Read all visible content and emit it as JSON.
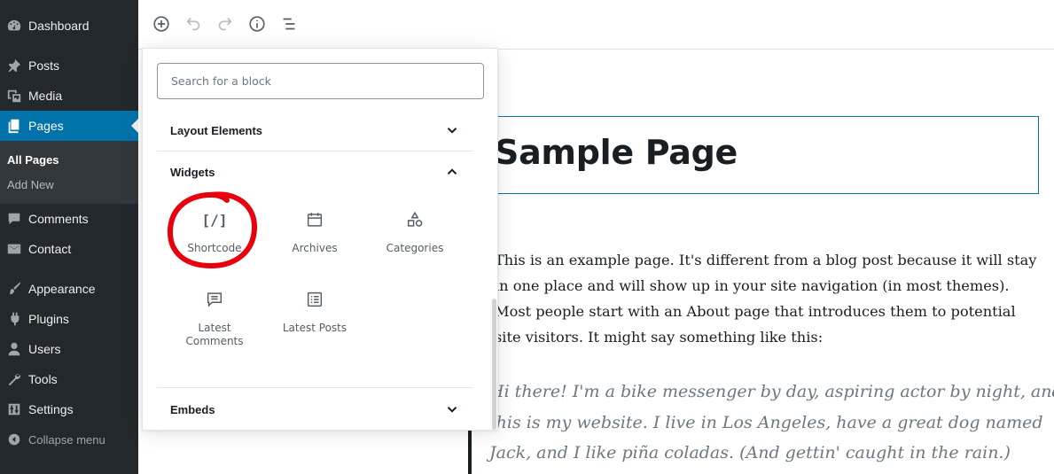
{
  "sidebar": {
    "items": [
      {
        "key": "dashboard",
        "label": "Dashboard",
        "icon": "dashboard-icon"
      },
      {
        "key": "posts",
        "label": "Posts",
        "icon": "pin-icon"
      },
      {
        "key": "media",
        "label": "Media",
        "icon": "media-icon"
      },
      {
        "key": "pages",
        "label": "Pages",
        "icon": "pages-icon",
        "active": true
      },
      {
        "key": "comments",
        "label": "Comments",
        "icon": "comment-icon"
      },
      {
        "key": "contact",
        "label": "Contact",
        "icon": "envelope-icon"
      },
      {
        "key": "appearance",
        "label": "Appearance",
        "icon": "paintbrush-icon"
      },
      {
        "key": "plugins",
        "label": "Plugins",
        "icon": "plug-icon"
      },
      {
        "key": "users",
        "label": "Users",
        "icon": "user-icon"
      },
      {
        "key": "tools",
        "label": "Tools",
        "icon": "wrench-icon"
      },
      {
        "key": "settings",
        "label": "Settings",
        "icon": "sliders-icon"
      }
    ],
    "submenu": [
      {
        "label": "All Pages",
        "current": true
      },
      {
        "label": "Add New"
      }
    ],
    "collapse_label": "Collapse menu",
    "accent_color": "#0073aa"
  },
  "toolbar": {
    "buttons": [
      "add-block-icon",
      "undo-icon",
      "redo-icon",
      "info-icon",
      "outline-icon"
    ]
  },
  "inserter": {
    "search_placeholder": "Search for a block",
    "sections": {
      "layout": {
        "label": "Layout Elements",
        "expanded": false
      },
      "widgets": {
        "label": "Widgets",
        "expanded": true,
        "blocks": [
          {
            "label": "Shortcode",
            "glyph": "[/]",
            "icon": "shortcode-icon"
          },
          {
            "label": "Archives",
            "icon": "calendar-icon"
          },
          {
            "label": "Categories",
            "icon": "shapes-icon"
          },
          {
            "label": "Latest Comments",
            "icon": "comments-icon"
          },
          {
            "label": "Latest Posts",
            "icon": "list-icon"
          }
        ]
      },
      "embeds": {
        "label": "Embeds",
        "expanded": false
      }
    },
    "annotation_color": "#e8000c"
  },
  "editor": {
    "title": "Sample Page",
    "paragraph_lines": [
      "This is an example page. It's different from a blog post because it will stay",
      "in one place and will show up in your site navigation (in most themes).",
      "Most people start with an About page that introduces them to potential",
      "site visitors. It might say something like this:"
    ],
    "quote_lines": [
      "Hi there! I'm a bike messenger by day, aspiring actor by night, and",
      "this is my website. I live in Los Angeles, have a great dog named",
      "Jack, and I like piña coladas. (And gettin' caught in the rain.)"
    ]
  }
}
